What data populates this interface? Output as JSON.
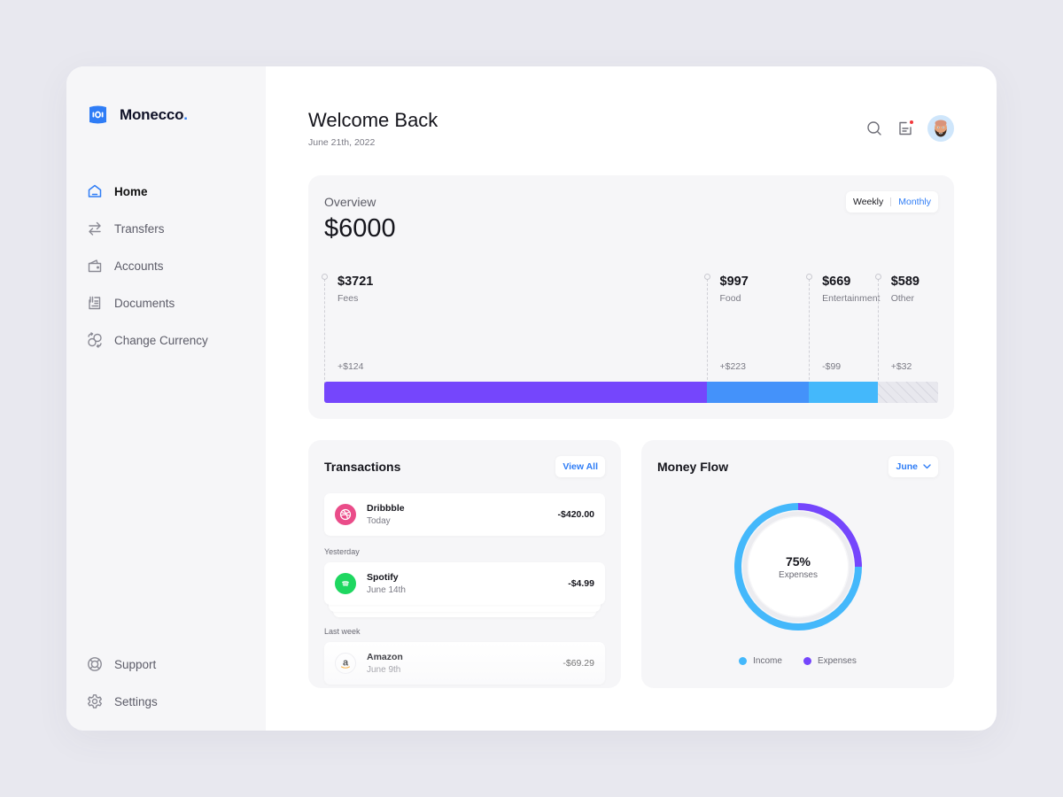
{
  "brand": {
    "name": "Monecco",
    "dot": ".",
    "accent": "#2f7df6"
  },
  "sidebar": {
    "items": [
      {
        "label": "Home",
        "icon": "home-icon",
        "active": true
      },
      {
        "label": "Transfers",
        "icon": "transfer-arrows-icon"
      },
      {
        "label": "Accounts",
        "icon": "wallet-icon"
      },
      {
        "label": "Documents",
        "icon": "document-icon"
      },
      {
        "label": "Change Currency",
        "icon": "currency-exchange-icon"
      }
    ],
    "bottom_items": [
      {
        "label": "Support",
        "icon": "lifebuoy-icon"
      },
      {
        "label": "Settings",
        "icon": "gear-icon"
      }
    ]
  },
  "header": {
    "title": "Welcome Back",
    "date": "June 21th, 2022",
    "icons": [
      "search-icon",
      "notification-icon",
      "avatar"
    ],
    "has_notification": true
  },
  "overview": {
    "title": "Overview",
    "total": "$6000",
    "toggle": {
      "options": [
        "Weekly",
        "Monthly"
      ],
      "selected": "Monthly"
    },
    "categories": [
      {
        "amount": "$3721",
        "name": "Fees",
        "change": "+$124",
        "value": 3721,
        "color": "#7546fc"
      },
      {
        "amount": "$997",
        "name": "Food",
        "change": "+$223",
        "value": 997,
        "color": "#4492fa"
      },
      {
        "amount": "$669",
        "name": "Entertainment",
        "change": "-$99",
        "value": 669,
        "color": "#44b8fb"
      },
      {
        "amount": "$589",
        "name": "Other",
        "change": "+$32",
        "value": 589,
        "color": "hatched"
      }
    ]
  },
  "transactions": {
    "title": "Transactions",
    "view_all": "View All",
    "groups": [
      {
        "label": "",
        "items": [
          {
            "name": "Dribbble",
            "date": "Today",
            "amount": "-$420.00",
            "icon": "dribbble-icon",
            "color": "#ea4c89"
          }
        ]
      },
      {
        "label": "Yesterday",
        "items": [
          {
            "name": "Spotify",
            "date": "June 14th",
            "amount": "-$4.99",
            "icon": "spotify-icon",
            "color": "#1ed760"
          }
        ]
      },
      {
        "label": "Last week",
        "items": [
          {
            "name": "Amazon",
            "date": "June 9th",
            "amount": "-$69.29",
            "icon": "amazon-icon",
            "color": "#ff9900"
          }
        ]
      }
    ]
  },
  "money_flow": {
    "title": "Money Flow",
    "month_select": "June",
    "center_value": "75%",
    "center_label": "Expenses",
    "legend": [
      {
        "label": "Income",
        "color": "#44b8fb"
      },
      {
        "label": "Expenses",
        "color": "#7546fc"
      }
    ]
  },
  "chart_data": {
    "type": "pie",
    "title": "Money Flow",
    "categories": [
      "Income",
      "Expenses"
    ],
    "values": [
      75,
      25
    ],
    "center_text": "75% Expenses",
    "legend_position": "bottom"
  }
}
